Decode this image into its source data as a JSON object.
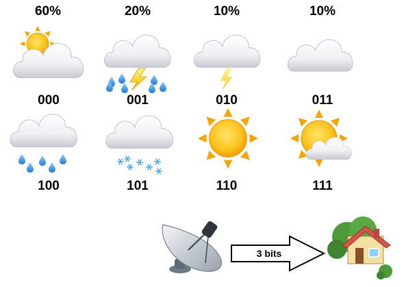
{
  "probabilities": [
    "60%",
    "20%",
    "10%",
    "10%"
  ],
  "codes": [
    "000",
    "001",
    "010",
    "011",
    "100",
    "101",
    "110",
    "111"
  ],
  "arrow_label": "3 bits",
  "icons": {
    "row1": [
      "sun-behind-cloud-icon",
      "cloud-lightning-rain-icon",
      "cloud-lightning-icon",
      "cloud-icon"
    ],
    "row2": [
      "cloud-rain-icon",
      "cloud-snow-icon",
      "sun-icon",
      "sun-behind-small-cloud-icon"
    ],
    "sender": "satellite-dish-icon",
    "receiver": "house-with-garden-icon"
  },
  "colors": {
    "sun": "#f7b500",
    "cloud": "#e9e9ee",
    "rain": "#3a8fe0",
    "lightning": "#f5c400",
    "snow": "#4aa8e8",
    "roof": "#d6554a",
    "tree": "#4f9a3a"
  }
}
